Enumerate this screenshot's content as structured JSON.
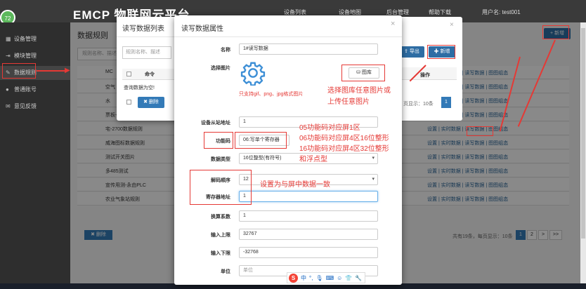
{
  "app": {
    "logo": "EMCP 物联网云平台",
    "avatar_text": "72",
    "topnav": [
      "设备列表",
      "设备地图",
      "后台管理",
      "帮助下载",
      "用户名: test001"
    ]
  },
  "sidebar": {
    "items": [
      {
        "label": "设备管理",
        "icon": "grid-icon"
      },
      {
        "label": "模块管理",
        "icon": "login-icon"
      },
      {
        "label": "数据规则",
        "icon": "pencil-icon"
      },
      {
        "label": "普通账号",
        "icon": "user-icon"
      },
      {
        "label": "意见反馈",
        "icon": "chat-icon"
      }
    ]
  },
  "main": {
    "title": "数据规则",
    "search_placeholder": "规则名称、描述",
    "add_button": "+ 新增",
    "rows": [
      {
        "name": "MC"
      },
      {
        "name": "空气"
      },
      {
        "name": "水"
      },
      {
        "name": "票板-新站管理"
      },
      {
        "name": "宅-2700数据规则"
      },
      {
        "name": "威海图标数据规则"
      },
      {
        "name": "测试开关图片"
      },
      {
        "name": "多485测试"
      },
      {
        "name": "宣传用测-永由PLC"
      },
      {
        "name": "农业气象站规则"
      }
    ],
    "row_ops": "设置 | 实时数据 | 读写数据 | 图图组态",
    "pager_info": "共有19条，每页显示：10条",
    "pages": [
      "1",
      "2",
      ">",
      ">>"
    ],
    "delete_button": "✖ 删除"
  },
  "list_modal": {
    "title": "读写数据列表",
    "search_placeholder": "规则名称、描述",
    "col_command": "命令",
    "empty_text": "查询数据为空!",
    "delete_button": "删除",
    "export_button": "导出",
    "add_button": "新增",
    "ops_header": "操作",
    "page_info": "页显示：10条",
    "page_current": "1"
  },
  "modal": {
    "title": "读写数据属性",
    "fields": {
      "name_label": "名称",
      "name_value": "1#读写数据",
      "image_label": "选择图片",
      "image_hint": "只支持gif、png、jpg格式图片",
      "library_button": "图库",
      "station_label": "设备从站地址",
      "station_value": "1",
      "func_label": "功能码",
      "func_value": "06:写单个寄存器",
      "dtype_label": "数据类型",
      "dtype_value": "16位整型(有符号)",
      "order_label": "解码顺序",
      "order_value": "12",
      "reg_label": "寄存器地址",
      "reg_value": "1",
      "ratio_label": "换算系数",
      "ratio_value": "1",
      "upper_label": "输入上限",
      "upper_value": "32767",
      "lower_label": "输入下限",
      "lower_value": "-32768",
      "unit_label": "单位",
      "unit_placeholder": "单位"
    }
  },
  "annotations": {
    "image_note_1": "选择图库任意图片或",
    "image_note_2": "上传任意图片",
    "func_note_1": "05功能码对应屏1区",
    "func_note_2": "06功能码对应屏4区16位整形",
    "func_note_3": "16功能码对应屏4区32位整形",
    "func_note_4": "和浮点型",
    "reg_note": "设置为与屏中数据一致"
  },
  "ime": {
    "logo": "S",
    "label": "中"
  },
  "colors": {
    "accent": "#337ab7",
    "annotation": "#e53935",
    "sidebar": "#2e2e2e"
  }
}
